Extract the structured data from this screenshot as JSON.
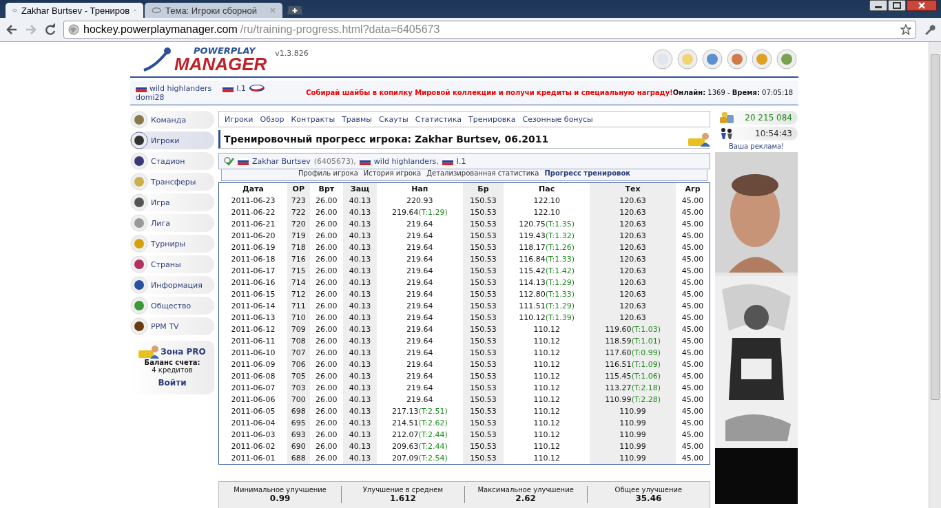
{
  "browser": {
    "tabs": [
      {
        "title": "Zakhar Burtsev - Трениров",
        "selected": true
      },
      {
        "title": "Тема: Игроки сборной",
        "selected": false
      }
    ],
    "url_host": "hockey.powerplaymanager.com",
    "url_path": "/ru/training-progress.html?data=6405673"
  },
  "header": {
    "version": "v1.3.826",
    "logo_top": "POWERPLAY",
    "logo_bottom": "MANAGER"
  },
  "userbar": {
    "team": "wild highlanders",
    "league": "I.1",
    "user": "domi28",
    "promo": "Собирай шайбы в копилку Мировой коллекции и получи кредиты и специальную награду!",
    "online_label": "Онлайн:",
    "online": "1369",
    "separator": "-",
    "time_label": "Время:",
    "time": "07:05:18"
  },
  "sidebar": {
    "items": [
      {
        "label": "Команда",
        "selected": false
      },
      {
        "label": "Игроки",
        "selected": true
      },
      {
        "label": "Стадион",
        "selected": false
      },
      {
        "label": "Трансферы",
        "selected": false
      },
      {
        "label": "Игра",
        "selected": false
      },
      {
        "label": "Лига",
        "selected": false
      },
      {
        "label": "Турниры",
        "selected": false
      },
      {
        "label": "Страны",
        "selected": false
      },
      {
        "label": "Информация",
        "selected": false
      },
      {
        "label": "Общество",
        "selected": false
      },
      {
        "label": "PPM TV",
        "selected": false
      }
    ],
    "pro": {
      "title": "Зона PRO",
      "balance_label": "Баланс счета:",
      "balance": "4 кредитов",
      "login": "Войти"
    }
  },
  "menu": [
    "Игроки",
    "Обзор",
    "Контракты",
    "Травмы",
    "Скауты",
    "Статистика",
    "Тренировка",
    "Сезонные бонусы"
  ],
  "page_title": "Тренировочный прогресс игрока: Zakhar Burtsev, 06.2011",
  "breadcrumb": {
    "player": "Zakhar Burtsev",
    "player_id": "(6405673),",
    "team": "wild highlanders,",
    "league": "I.1"
  },
  "subtabs": [
    {
      "label": "Профиль игрока",
      "selected": false
    },
    {
      "label": "История игрока",
      "selected": false
    },
    {
      "label": "Детализированная статистика",
      "selected": false
    },
    {
      "label": "Прогресс тренировок",
      "selected": true
    }
  ],
  "table": {
    "columns": [
      "Дата",
      "ОР",
      "Врт",
      "Защ",
      "Нап",
      "Бр",
      "Пас",
      "Тех",
      "Агр"
    ],
    "rows": [
      {
        "values": [
          "2011-06-23",
          "723",
          "26.00",
          "40.13",
          "220.93",
          "150.53",
          "122.10",
          "120.63",
          "45.00"
        ],
        "gains": {}
      },
      {
        "values": [
          "2011-06-22",
          "722",
          "26.00",
          "40.13",
          "219.64",
          "150.53",
          "122.10",
          "120.63",
          "45.00"
        ],
        "gains": {
          "4": "(T:1.29)"
        }
      },
      {
        "values": [
          "2011-06-21",
          "720",
          "26.00",
          "40.13",
          "219.64",
          "150.53",
          "120.75",
          "120.63",
          "45.00"
        ],
        "gains": {
          "6": "(T:1.35)"
        }
      },
      {
        "values": [
          "2011-06-20",
          "719",
          "26.00",
          "40.13",
          "219.64",
          "150.53",
          "119.43",
          "120.63",
          "45.00"
        ],
        "gains": {
          "6": "(T:1.32)"
        }
      },
      {
        "values": [
          "2011-06-19",
          "718",
          "26.00",
          "40.13",
          "219.64",
          "150.53",
          "118.17",
          "120.63",
          "45.00"
        ],
        "gains": {
          "6": "(T:1.26)"
        }
      },
      {
        "values": [
          "2011-06-18",
          "716",
          "26.00",
          "40.13",
          "219.64",
          "150.53",
          "116.84",
          "120.63",
          "45.00"
        ],
        "gains": {
          "6": "(T:1.33)"
        }
      },
      {
        "values": [
          "2011-06-17",
          "715",
          "26.00",
          "40.13",
          "219.64",
          "150.53",
          "115.42",
          "120.63",
          "45.00"
        ],
        "gains": {
          "6": "(T:1.42)"
        }
      },
      {
        "values": [
          "2011-06-16",
          "714",
          "26.00",
          "40.13",
          "219.64",
          "150.53",
          "114.13",
          "120.63",
          "45.00"
        ],
        "gains": {
          "6": "(T:1.29)"
        }
      },
      {
        "values": [
          "2011-06-15",
          "712",
          "26.00",
          "40.13",
          "219.64",
          "150.53",
          "112.80",
          "120.63",
          "45.00"
        ],
        "gains": {
          "6": "(T:1.33)"
        }
      },
      {
        "values": [
          "2011-06-14",
          "711",
          "26.00",
          "40.13",
          "219.64",
          "150.53",
          "111.51",
          "120.63",
          "45.00"
        ],
        "gains": {
          "6": "(T:1.29)"
        }
      },
      {
        "values": [
          "2011-06-13",
          "710",
          "26.00",
          "40.13",
          "219.64",
          "150.53",
          "110.12",
          "120.63",
          "45.00"
        ],
        "gains": {
          "6": "(T:1.39)"
        }
      },
      {
        "values": [
          "2011-06-12",
          "709",
          "26.00",
          "40.13",
          "219.64",
          "150.53",
          "110.12",
          "119.60",
          "45.00"
        ],
        "gains": {
          "7": "(T:1.03)"
        }
      },
      {
        "values": [
          "2011-06-11",
          "708",
          "26.00",
          "40.13",
          "219.64",
          "150.53",
          "110.12",
          "118.59",
          "45.00"
        ],
        "gains": {
          "7": "(T:1.01)"
        }
      },
      {
        "values": [
          "2011-06-10",
          "707",
          "26.00",
          "40.13",
          "219.64",
          "150.53",
          "110.12",
          "117.60",
          "45.00"
        ],
        "gains": {
          "7": "(T:0.99)"
        }
      },
      {
        "values": [
          "2011-06-09",
          "706",
          "26.00",
          "40.13",
          "219.64",
          "150.53",
          "110.12",
          "116.51",
          "45.00"
        ],
        "gains": {
          "7": "(T:1.09)"
        }
      },
      {
        "values": [
          "2011-06-08",
          "705",
          "26.00",
          "40.13",
          "219.64",
          "150.53",
          "110.12",
          "115.45",
          "45.00"
        ],
        "gains": {
          "7": "(T:1.06)"
        }
      },
      {
        "values": [
          "2011-06-07",
          "703",
          "26.00",
          "40.13",
          "219.64",
          "150.53",
          "110.12",
          "113.27",
          "45.00"
        ],
        "gains": {
          "7": "(T:2.18)"
        }
      },
      {
        "values": [
          "2011-06-06",
          "700",
          "26.00",
          "40.13",
          "219.64",
          "150.53",
          "110.12",
          "110.99",
          "45.00"
        ],
        "gains": {
          "7": "(T:2.28)"
        }
      },
      {
        "values": [
          "2011-06-05",
          "698",
          "26.00",
          "40.13",
          "217.13",
          "150.53",
          "110.12",
          "110.99",
          "45.00"
        ],
        "gains": {
          "4": "(T:2.51)"
        }
      },
      {
        "values": [
          "2011-06-04",
          "695",
          "26.00",
          "40.13",
          "214.51",
          "150.53",
          "110.12",
          "110.99",
          "45.00"
        ],
        "gains": {
          "4": "(T:2.62)"
        }
      },
      {
        "values": [
          "2011-06-03",
          "693",
          "26.00",
          "40.13",
          "212.07",
          "150.53",
          "110.12",
          "110.99",
          "45.00"
        ],
        "gains": {
          "4": "(T:2.44)"
        }
      },
      {
        "values": [
          "2011-06-02",
          "690",
          "26.00",
          "40.13",
          "209.63",
          "150.53",
          "110.12",
          "110.99",
          "45.00"
        ],
        "gains": {
          "4": "(T:2.44)"
        }
      },
      {
        "values": [
          "2011-06-01",
          "688",
          "26.00",
          "40.13",
          "207.09",
          "150.53",
          "110.12",
          "110.99",
          "45.00"
        ],
        "gains": {
          "4": "(T:2.54)"
        }
      }
    ]
  },
  "summary": [
    {
      "label": "Минимальное улучшение",
      "value": "0.99"
    },
    {
      "label": "Улучшение в среднем",
      "value": "1.612"
    },
    {
      "label": "Максимальное улучшение",
      "value": "2.62"
    },
    {
      "label": "Общее улучшение",
      "value": "35.46"
    }
  ],
  "right": {
    "money": "20 215 084",
    "clock": "10:54:43",
    "ad_link": "Ваша реклама!"
  }
}
